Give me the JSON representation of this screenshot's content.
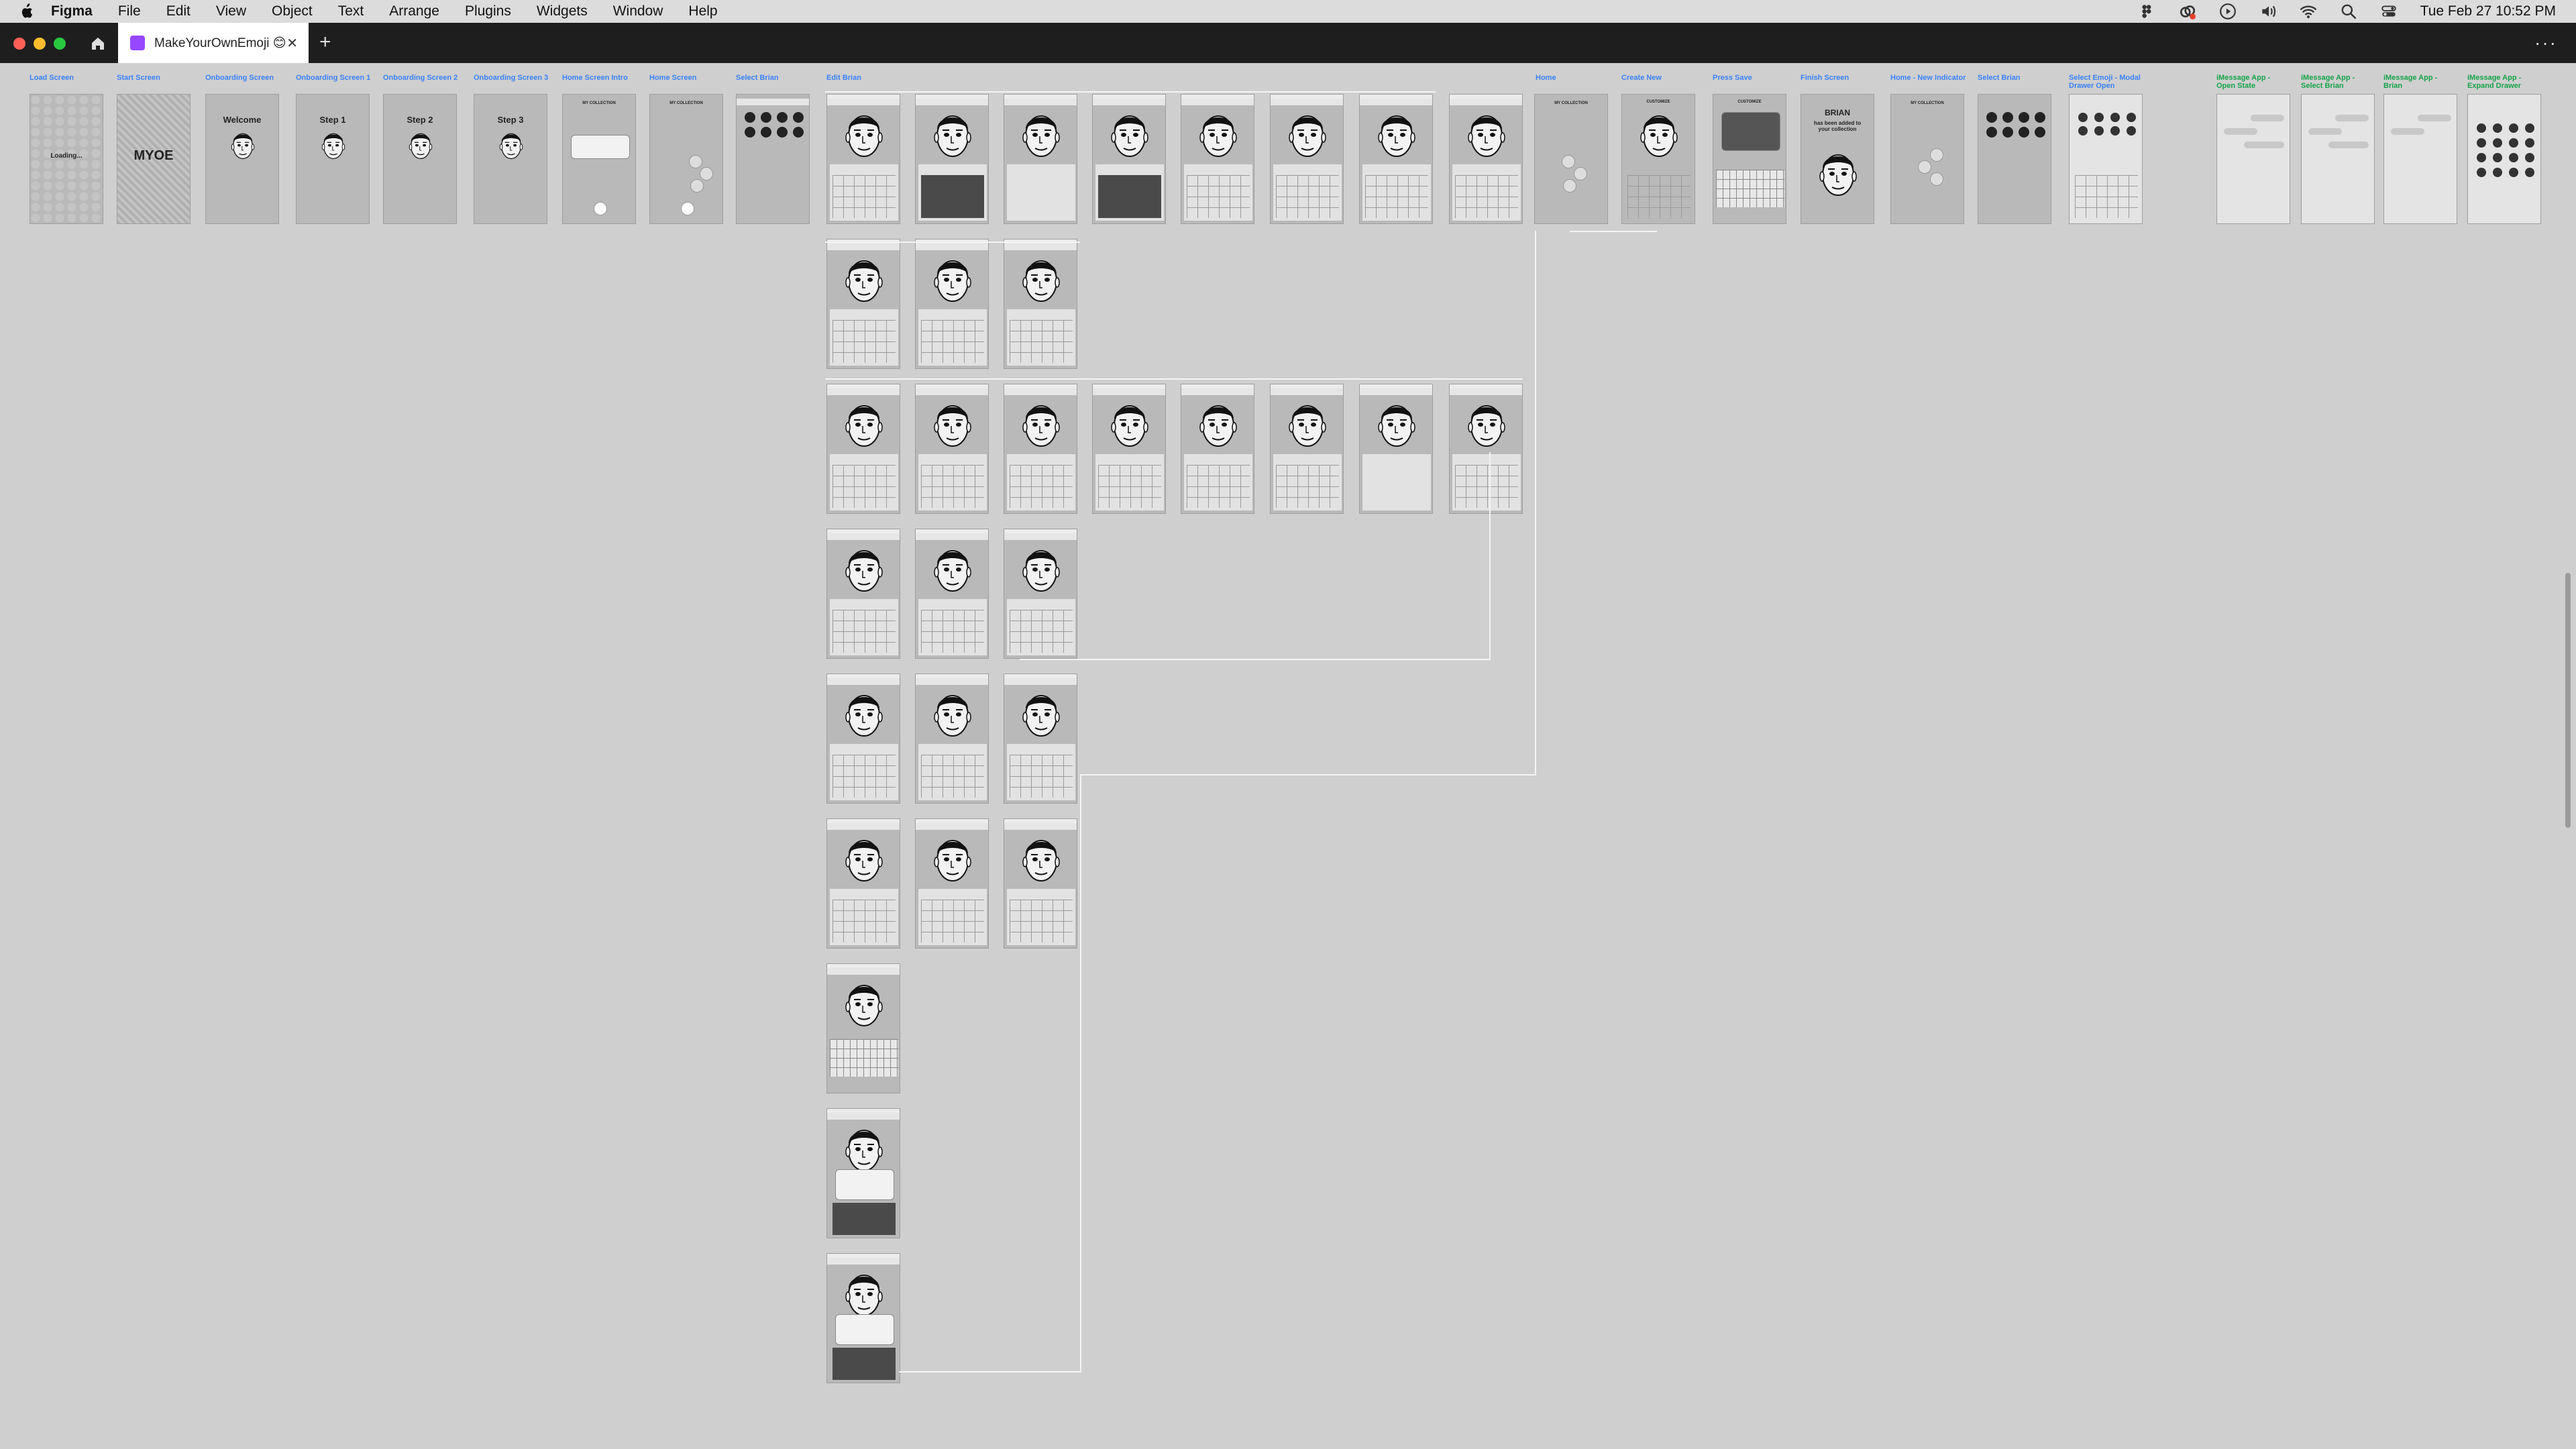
{
  "menubar": {
    "app_name": "Figma",
    "menus": [
      "File",
      "Edit",
      "View",
      "Object",
      "Text",
      "Arrange",
      "Plugins",
      "Widgets",
      "Window",
      "Help"
    ],
    "clock": "Tue Feb 27  10:52 PM",
    "status_icons": [
      "figma-icon",
      "creative-cloud-icon",
      "play-icon",
      "volume-icon",
      "wifi-icon",
      "search-icon",
      "control-center-icon"
    ]
  },
  "tabbar": {
    "file_title": "MakeYourOwnEmoji 😊",
    "new_tab": "+",
    "overflow": "···"
  },
  "canvas": {
    "top_row_labels": [
      "Load Screen",
      "Start Screen",
      "Onboarding Screen",
      "Onboarding Screen 1",
      "Onboarding Screen 2",
      "Onboarding Screen 3",
      "Home Screen Intro",
      "Home Screen",
      "Select Brian",
      "Edit Brian"
    ],
    "right_group_labels": [
      "Home",
      "Create New",
      "Press Save",
      "Finish Screen",
      "Home - New Indicator",
      "Select Brian",
      "Select Emoji - Modal Drawer Open"
    ],
    "imessage_labels": [
      "iMessage App - Open State",
      "iMessage App - Select Brian",
      "iMessage App - Brian",
      "iMessage App - Expand Drawer"
    ],
    "screen_text": {
      "loading": "Loading...",
      "myoe": "MYOE",
      "welcome": "Welcome",
      "step1": "Step 1",
      "step2": "Step 2",
      "step3": "Step 3",
      "my_collection": "MY COLLECTION",
      "brian": "BRIAN",
      "customize": "CUSTOMIZE",
      "brian_big": "BRIAN",
      "added": "has been added to your collection"
    }
  }
}
